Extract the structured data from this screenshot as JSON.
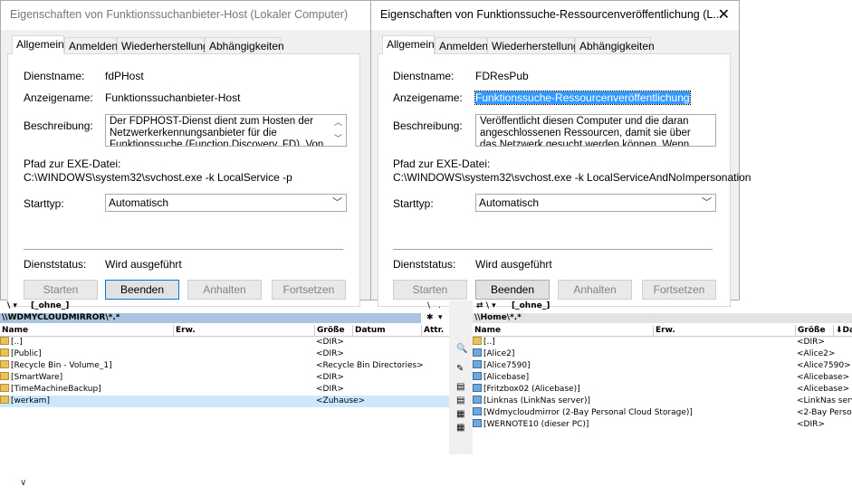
{
  "left_dialog": {
    "title": "Eigenschaften von Funktionssuchanbieter-Host (Lokaler Computer)",
    "tabs": [
      "Allgemein",
      "Anmelden",
      "Wiederherstellung",
      "Abhängigkeiten"
    ],
    "dienstname_label": "Dienstname:",
    "dienstname": "fdPHost",
    "anzeigename_label": "Anzeigename:",
    "anzeigename": "Funktionssuchanbieter-Host",
    "beschreibung_label": "Beschreibung:",
    "beschreibung": "Der FDPHOST-Dienst dient zum Hosten der Netzwerkerkennungsanbieter für die Funktionssuche (Function Discovery, FD). Von",
    "pfad_label": "Pfad zur EXE-Datei:",
    "pfad": "C:\\WINDOWS\\system32\\svchost.exe -k LocalService -p",
    "starttyp_label": "Starttyp:",
    "starttyp": "Automatisch",
    "status_label": "Dienststatus:",
    "status": "Wird ausgeführt",
    "buttons": {
      "starten": "Starten",
      "beenden": "Beenden",
      "anhalten": "Anhalten",
      "fortsetzen": "Fortsetzen"
    }
  },
  "right_dialog": {
    "title": "Eigenschaften von Funktionssuche-Ressourcenveröffentlichung (L...",
    "tabs": [
      "Allgemein",
      "Anmelden",
      "Wiederherstellung",
      "Abhängigkeiten"
    ],
    "dienstname_label": "Dienstname:",
    "dienstname": "FDResPub",
    "anzeigename_label": "Anzeigename:",
    "anzeigename": "Funktionssuche-Ressourcenveröffentlichung",
    "beschreibung_label": "Beschreibung:",
    "beschreibung": "Veröffentlicht diesen Computer und die daran angeschlossenen Ressourcen, damit sie über das Netzwerk gesucht werden können. Wenn dieser",
    "pfad_label": "Pfad zur EXE-Datei:",
    "pfad": "C:\\WINDOWS\\system32\\svchost.exe -k LocalServiceAndNoImpersonation",
    "starttyp_label": "Starttyp:",
    "starttyp": "Automatisch",
    "status_label": "Dienststatus:",
    "status": "Wird ausgeführt",
    "buttons": {
      "starten": "Starten",
      "beenden": "Beenden",
      "anhalten": "Anhalten",
      "fortsetzen": "Fortsetzen"
    }
  },
  "left_panel": {
    "drive": "\\",
    "drive_label": "[_ohne_]",
    "path": "\\\\WDMYCLOUDMIRROR\\*.*",
    "columns": {
      "name": "Name",
      "ext": "Erw.",
      "size": "Größe",
      "date": "Datum",
      "attr": "Attr."
    },
    "rows": [
      {
        "name": "[..]",
        "size": "<DIR>"
      },
      {
        "name": "[Public]",
        "size": "<DIR>"
      },
      {
        "name": "[Recycle Bin - Volume_1]",
        "size": "<Recycle Bin Directories>"
      },
      {
        "name": "[SmartWare]",
        "size": "<DIR>"
      },
      {
        "name": "[TimeMachineBackup]",
        "size": "<DIR>"
      },
      {
        "name": "[werkam]",
        "size": "<Zuhause>"
      }
    ]
  },
  "right_panel": {
    "drive": "\\",
    "drive_label": "[_ohne_]",
    "path": "\\\\Home\\*.*",
    "columns": {
      "name": "Name",
      "ext": "Erw.",
      "size": "Größe",
      "date": "Da"
    },
    "rows": [
      {
        "name": "[..]",
        "size": "<DIR>"
      },
      {
        "name": "[Alice2]",
        "size": "<Alice2>"
      },
      {
        "name": "[Alice7590]",
        "size": "<Alice7590>"
      },
      {
        "name": "[Alicebase]",
        "size": "<Alicebase>"
      },
      {
        "name": "[Fritzbox02 (Alicebase)]",
        "size": "<Alicebase>"
      },
      {
        "name": "[Linknas (LinkNas server)]",
        "size": "<LinkNas serv"
      },
      {
        "name": "[Wdmycloudmirror (2-Bay Personal Cloud Storage)]",
        "size": "<2-Bay Perso"
      },
      {
        "name": "[WERNOTE10 (dieser PC)]",
        "size": "<DIR>"
      }
    ]
  },
  "colors": {
    "selection": "#3399ff",
    "path_active": "#a8c4e0",
    "row_highlight": "#cce8ff",
    "default_button_border": "#0078d7"
  }
}
